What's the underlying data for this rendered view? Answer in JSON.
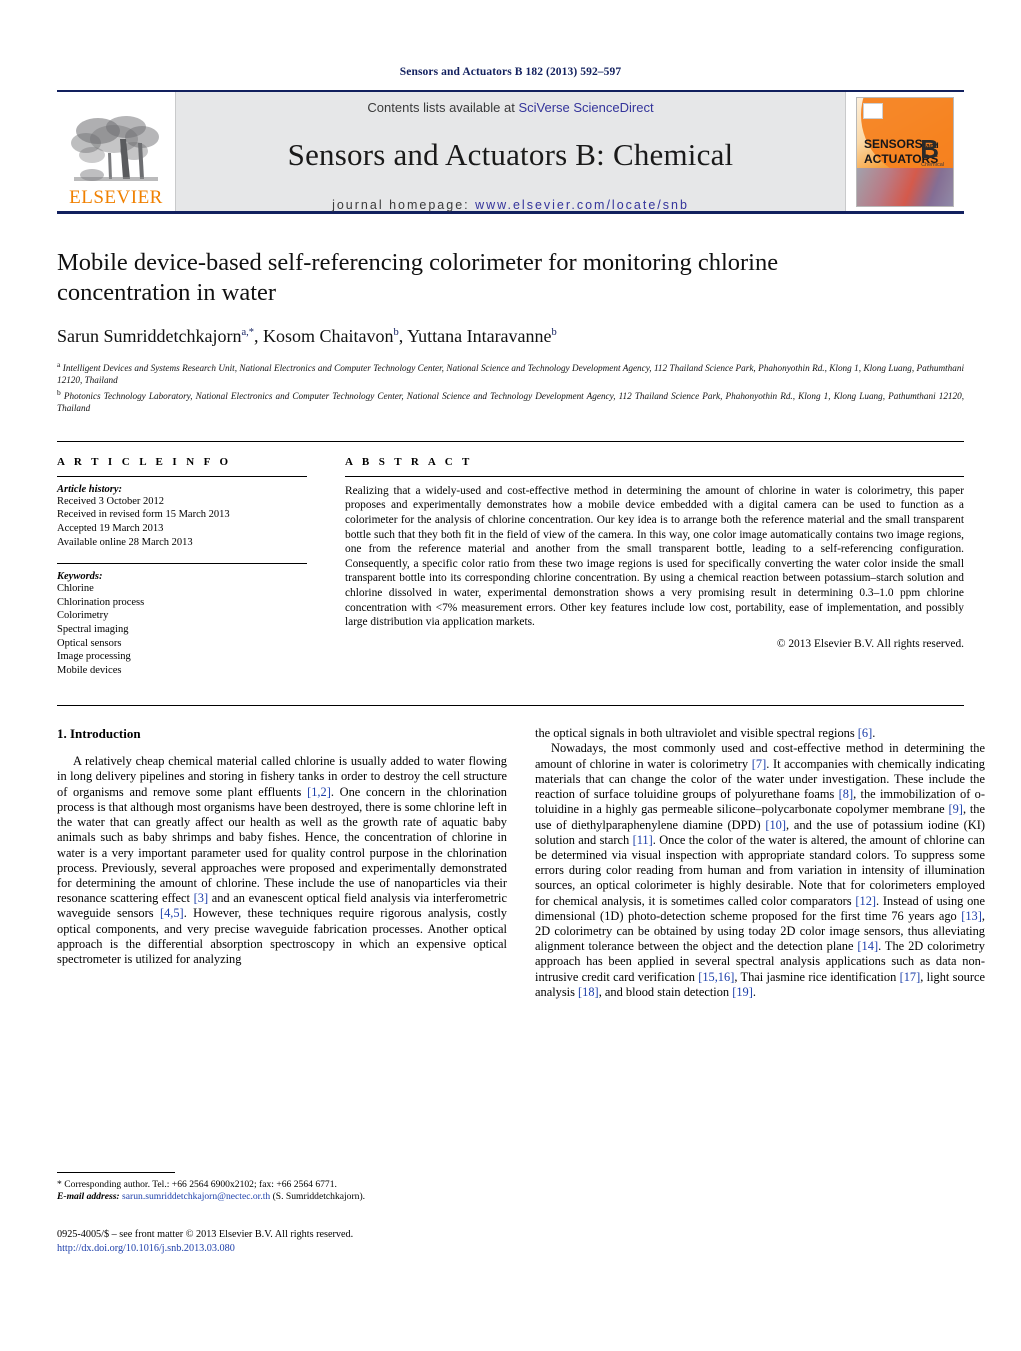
{
  "running_head": "Sensors and Actuators B 182 (2013) 592–597",
  "masthead": {
    "publisher_name": "ELSEVIER",
    "contents_prefix": "Contents lists available at ",
    "contents_link": "SciVerse ScienceDirect",
    "journal_title": "Sensors and Actuators B: Chemical",
    "homepage_prefix": "journal homepage: ",
    "homepage_link": "www.elsevier.com/locate/snb",
    "cover": {
      "line1": "SENSORS",
      "line1_small": "and",
      "line2": "ACTUATORS",
      "letter": "B",
      "sublabel": "Chemical"
    }
  },
  "article": {
    "title": "Mobile device-based self-referencing colorimeter for monitoring chlorine concentration in water",
    "authors_plain": "Sarun Sumriddetchkajorn",
    "author2": ", Kosom Chaitavon",
    "author3": ", Yuttana Intaravanne",
    "sup1": "a,*",
    "sup2": "b",
    "sup3": "b",
    "affiliation_a": "Intelligent Devices and Systems Research Unit, National Electronics and Computer Technology Center, National Science and Technology Development Agency, 112 Thailand Science Park, Phahonyothin Rd., Klong 1, Klong Luang, Pathumthani 12120, Thailand",
    "affiliation_b": "Photonics Technology Laboratory, National Electronics and Computer Technology Center, National Science and Technology Development Agency, 112 Thailand Science Park, Phahonyothin Rd., Klong 1, Klong Luang, Pathumthani 12120, Thailand",
    "affil_marker_a": "a",
    "affil_marker_b": "b"
  },
  "article_info": {
    "heading": "A R T I C L E    I N F O",
    "history_label": "Article history:",
    "history": [
      "Received 3 October 2012",
      "Received in revised form 15 March 2013",
      "Accepted 19 March 2013",
      "Available online 28 March 2013"
    ],
    "keywords_label": "Keywords:",
    "keywords": [
      "Chlorine",
      "Chlorination process",
      "Colorimetry",
      "Spectral imaging",
      "Optical sensors",
      "Image processing",
      "Mobile devices"
    ]
  },
  "abstract": {
    "heading": "A B S T R A C T",
    "text": "Realizing that a widely-used and cost-effective method in determining the amount of chlorine in water is colorimetry, this paper proposes and experimentally demonstrates how a mobile device embedded with a digital camera can be used to function as a colorimeter for the analysis of chlorine concentration. Our key idea is to arrange both the reference material and the small transparent bottle such that they both fit in the field of view of the camera. In this way, one color image automatically contains two image regions, one from the reference material and another from the small transparent bottle, leading to a self-referencing configuration. Consequently, a specific color ratio from these two image regions is used for specifically converting the water color inside the small transparent bottle into its corresponding chlorine concentration. By using a chemical reaction between potassium–starch solution and chlorine dissolved in water, experimental demonstration shows a very promising result in determining 0.3–1.0 ppm chlorine concentration with <7% measurement errors. Other key features include low cost, portability, ease of implementation, and possibly large distribution via application markets.",
    "copyright": "© 2013 Elsevier B.V. All rights reserved."
  },
  "body": {
    "section_heading": "1. Introduction",
    "left_p1_a": "A relatively cheap chemical material called chlorine is usually added to water flowing in long delivery pipelines and storing in fishery tanks in order to destroy the cell structure of organisms and remove some plant effluents ",
    "left_ref_12": "[1,2]",
    "left_p1_b": ". One concern in the chlorination process is that although most organisms have been destroyed, there is some chlorine left in the water that can greatly affect our health as well as the growth rate of aquatic baby animals such as baby shrimps and baby fishes. Hence, the concentration of chlorine in water is a very important parameter used for quality control purpose in the chlorination process. Previously, several approaches were proposed and experimentally demonstrated for determining the amount of chlorine. These include the use of nanoparticles via their resonance scattering effect ",
    "left_ref_3": "[3]",
    "left_p1_c": " and an evanescent optical field analysis via interferometric waveguide sensors ",
    "left_ref_45": "[4,5]",
    "left_p1_d": ". However, these techniques require rigorous analysis, costly optical components, and very precise waveguide fabrication processes. Another optical approach is the differential absorption spectroscopy in which an expensive optical spectrometer is utilized for analyzing",
    "right_p1_a": "the optical signals in both ultraviolet and visible spectral regions ",
    "right_ref_6": "[6]",
    "right_p1_b": ".",
    "right_p2_a": "Nowadays, the most commonly used and cost-effective method in determining the amount of chlorine in water is colorimetry ",
    "right_ref_7": "[7]",
    "right_p2_b": ". It accompanies with chemically indicating materials that can change the color of the water under investigation. These include the reaction of surface toluidine groups of polyurethane foams ",
    "right_ref_8": "[8]",
    "right_p2_c": ", the immobilization of o-toluidine in a highly gas permeable silicone–polycarbonate copolymer membrane ",
    "right_ref_9": "[9]",
    "right_p2_d": ", the use of diethylparaphenylene diamine (DPD) ",
    "right_ref_10": "[10]",
    "right_p2_e": ", and the use of potassium iodine (KI) solution and starch ",
    "right_ref_11": "[11]",
    "right_p2_f": ". Once the color of the water is altered, the amount of chlorine can be determined via visual inspection with appropriate standard colors. To suppress some errors during color reading from human and from variation in intensity of illumination sources, an optical colorimeter is highly desirable. Note that for colorimeters employed for chemical analysis, it is sometimes called color comparators ",
    "right_ref_12": "[12]",
    "right_p2_g": ". Instead of using one dimensional (1D) photo-detection scheme proposed for the first time 76 years ago ",
    "right_ref_13": "[13]",
    "right_p2_h": ", 2D colorimetry can be obtained by using today 2D color image sensors, thus alleviating alignment tolerance between the object and the detection plane ",
    "right_ref_14": "[14]",
    "right_p2_i": ". The 2D colorimetry approach has been applied in several spectral analysis applications such as data non-intrusive credit card verification ",
    "right_ref_1516": "[15,16]",
    "right_p2_j": ", Thai jasmine rice identification ",
    "right_ref_17": "[17]",
    "right_p2_k": ", light source analysis ",
    "right_ref_18": "[18]",
    "right_p2_l": ", and blood stain detection ",
    "right_ref_19": "[19]",
    "right_p2_m": "."
  },
  "footnotes": {
    "corresponding": "* Corresponding author. Tel.: +66 2564 6900x2102; fax: +66 2564 6771.",
    "email_label": "E-mail address:",
    "email": " sarun.sumriddetchkajorn@nectec.or.th",
    "email_owner": " (S. Sumriddetchkajorn).",
    "imprint": "0925-4005/$ – see front matter © 2013 Elsevier B.V. All rights reserved.",
    "doi": "http://dx.doi.org/10.1016/j.snb.2013.03.080"
  },
  "colors": {
    "navy": "#12205e",
    "link_blue": "#34349b",
    "ref_blue": "#1d3faa",
    "elsevier_orange": "#f08000",
    "band_gray": "#e6e7e8"
  }
}
